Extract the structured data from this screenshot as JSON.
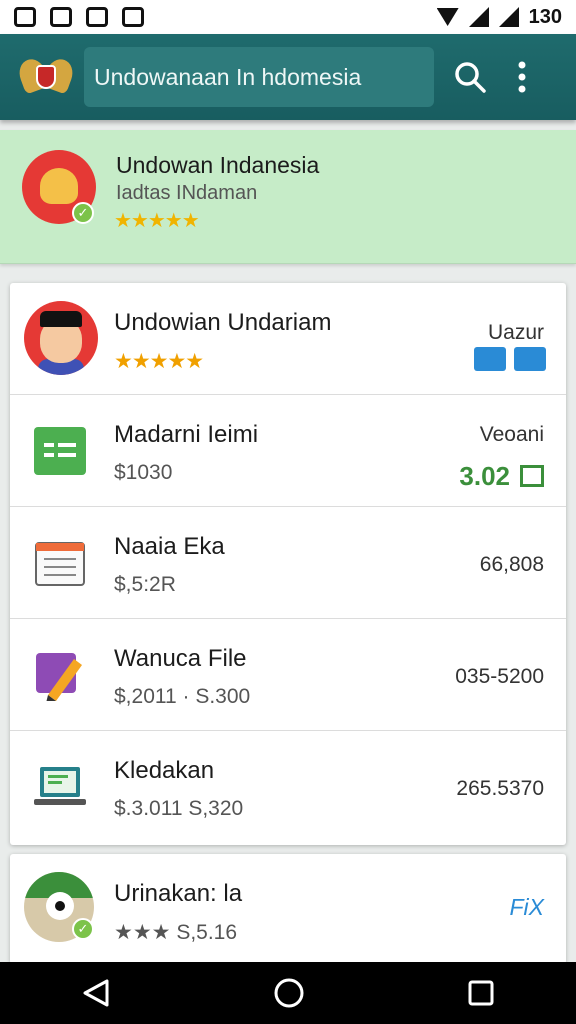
{
  "status_bar": {
    "time": "130"
  },
  "app_bar": {
    "title": "Undowanaan In hdomesia"
  },
  "featured": {
    "title": "Undowan Indanesia",
    "subtitle": "Iadtas INdaman",
    "stars": "★★★★★"
  },
  "list": {
    "items": [
      {
        "title": "Undowian Undariam",
        "subtitle": "★★★★★",
        "right": "Uazur"
      },
      {
        "title": "Madarni Ieimi",
        "subtitle": "$1030",
        "right": "Veoani",
        "right_value": "3.02"
      },
      {
        "title": "Naaia Eka",
        "subtitle": "$,5:2R",
        "right": "66,808"
      },
      {
        "title": "Wanuca File",
        "subtitle": "$,2011 · S.300",
        "right": "035-5200"
      },
      {
        "title": "Kledakan",
        "subtitle": "$.3.011 S,320",
        "right": "265.5370"
      }
    ]
  },
  "bottom_item": {
    "title": "Urinakan: la",
    "subtitle": "★★★ S,5.16",
    "right": "FiX"
  },
  "colors": {
    "app_bar": "#1f6b6d",
    "featured_bg": "#c6ecc8",
    "accent_green": "#3b8f3b",
    "accent_blue": "#2a8bd6"
  }
}
